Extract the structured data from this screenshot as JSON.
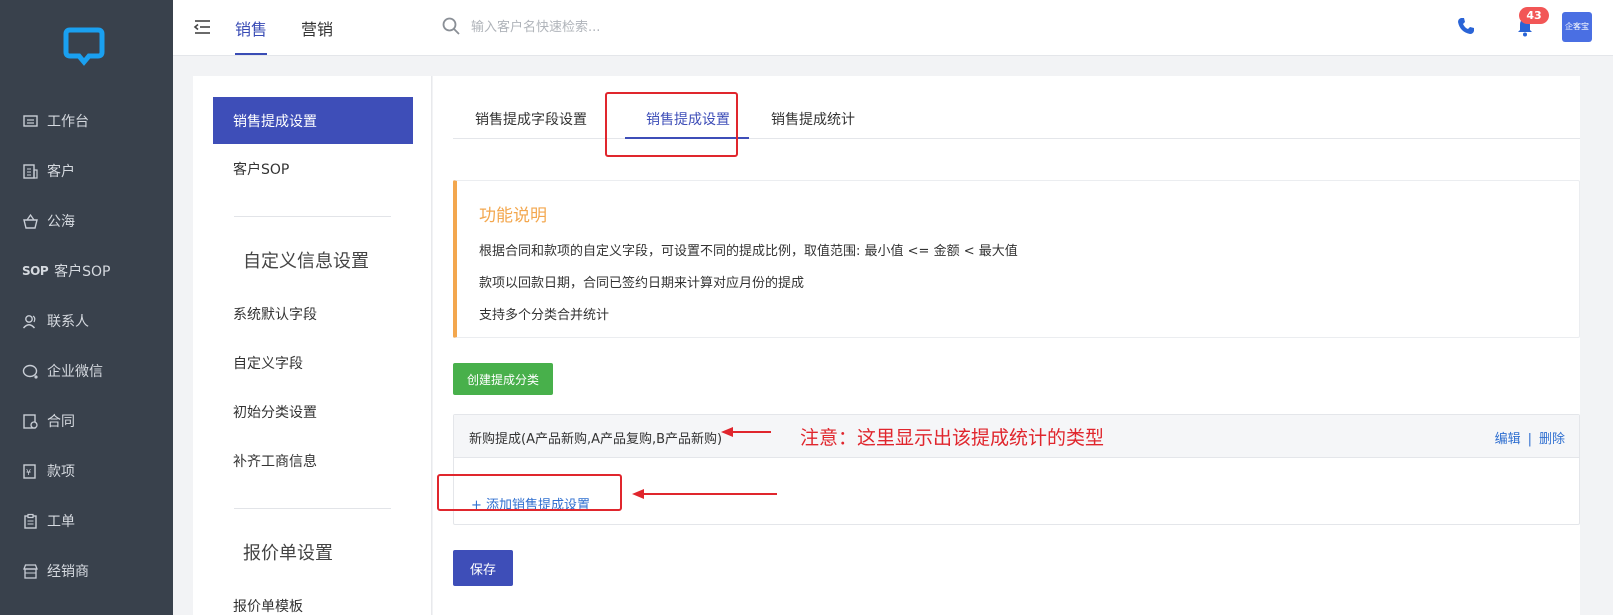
{
  "nav": {
    "items": [
      {
        "label": "工作台",
        "icon": "monitor-icon"
      },
      {
        "label": "客户",
        "icon": "building-icon"
      },
      {
        "label": "公海",
        "icon": "basket-icon"
      },
      {
        "label": "客户SOP",
        "icon": "sop-icon",
        "icon_text": "SOP"
      },
      {
        "label": "联系人",
        "icon": "contacts-icon"
      },
      {
        "label": "企业微信",
        "icon": "chat-icon"
      },
      {
        "label": "合同",
        "icon": "contract-icon"
      },
      {
        "label": "款项",
        "icon": "payment-icon"
      },
      {
        "label": "工单",
        "icon": "clipboard-icon"
      },
      {
        "label": "经销商",
        "icon": "store-icon"
      }
    ]
  },
  "topbar": {
    "tabs": [
      "销售",
      "营销"
    ],
    "active_tab": "销售",
    "search_placeholder": "输入客户名快速检索...",
    "notification_count": "43",
    "avatar_text": "企客宝"
  },
  "settings_menu": {
    "item_active": "销售提成设置",
    "item_sop": "客户SOP",
    "section_custom": "自定义信息设置",
    "item_default_fields": "系统默认字段",
    "item_custom_fields": "自定义字段",
    "item_initial_category": "初始分类设置",
    "item_business_info": "补齐工商信息",
    "section_quote": "报价单设置",
    "item_quote_template": "报价单模板"
  },
  "content": {
    "tabs": [
      "销售提成字段设置",
      "销售提成设置",
      "销售提成统计"
    ],
    "active_tab": "销售提成设置",
    "notice": {
      "title": "功能说明",
      "lines": [
        "根据合同和款项的自定义字段，可设置不同的提成比例，取值范围: 最小值 <= 金额 < 最大值",
        "款项以回款日期，合同已签约日期来计算对应月份的提成",
        "支持多个分类合并统计"
      ]
    },
    "create_button": "创建提成分类",
    "category": {
      "name": "新购提成(A产品新购,A产品复购,B产品新购)",
      "annotation": "注意：这里显示出该提成统计的类型",
      "edit": "编辑",
      "separator": "|",
      "delete": "删除",
      "add_link": "+ 添加销售提成设置"
    },
    "save_button": "保存"
  },
  "colors": {
    "nav_bg": "#39414c",
    "accent": "#3e4eb8",
    "green": "#48b04b",
    "warning": "#f3a74e",
    "annotation_red": "#e0262d",
    "link": "#2f6fd0"
  }
}
